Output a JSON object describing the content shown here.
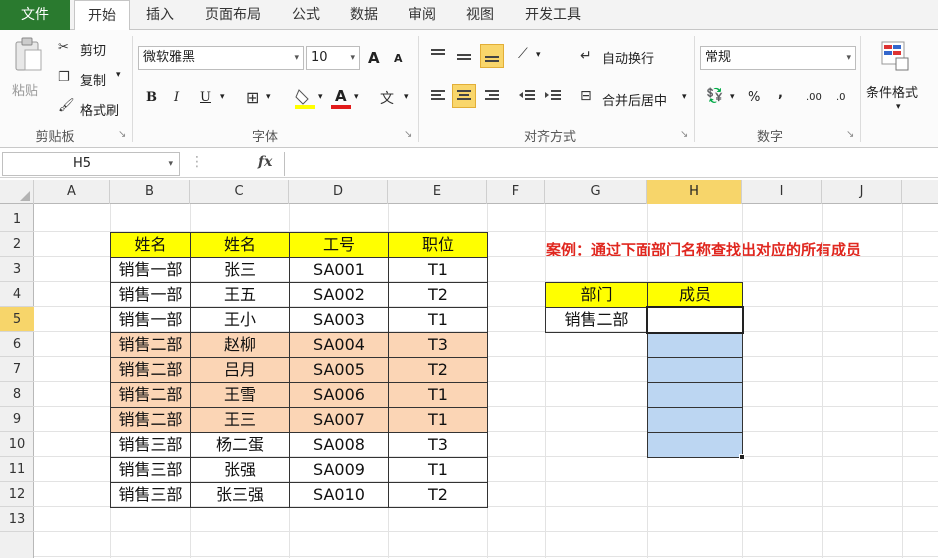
{
  "tabs": [
    "文件",
    "开始",
    "插入",
    "页面布局",
    "公式",
    "数据",
    "审阅",
    "视图",
    "开发工具"
  ],
  "clipboard": {
    "paste": "粘贴",
    "cut": "剪切",
    "copy": "复制",
    "format_painter": "格式刷",
    "group": "剪贴板"
  },
  "font": {
    "name": "微软雅黑",
    "size": "10",
    "grow": "A",
    "shrink": "A",
    "bold": "B",
    "italic": "I",
    "underline": "U",
    "group": "字体"
  },
  "alignment": {
    "wrap": "自动换行",
    "merge": "合并后居中",
    "group": "对齐方式"
  },
  "number": {
    "format": "常规",
    "percent": "%",
    "comma": ",",
    "inc": ".00",
    "dec": ".0",
    "group": "数字"
  },
  "styles": {
    "conditional": "条件格式"
  },
  "namebox": "H5",
  "fx": "fx",
  "columns": [
    "A",
    "B",
    "C",
    "D",
    "E",
    "F",
    "G",
    "H",
    "I",
    "J"
  ],
  "rows": [
    "1",
    "2",
    "3",
    "4",
    "5",
    "6",
    "7",
    "8",
    "9",
    "10",
    "11",
    "12",
    "13"
  ],
  "table": {
    "headers": [
      "姓名",
      "姓名",
      "工号",
      "职位"
    ],
    "rows": [
      [
        "销售一部",
        "张三",
        "SA001",
        "T1"
      ],
      [
        "销售一部",
        "王五",
        "SA002",
        "T2"
      ],
      [
        "销售一部",
        "王小",
        "SA003",
        "T1"
      ],
      [
        "销售二部",
        "赵柳",
        "SA004",
        "T3"
      ],
      [
        "销售二部",
        "吕月",
        "SA005",
        "T2"
      ],
      [
        "销售二部",
        "王雪",
        "SA006",
        "T1"
      ],
      [
        "销售二部",
        "王三",
        "SA007",
        "T1"
      ],
      [
        "销售三部",
        "杨二蛋",
        "SA008",
        "T3"
      ],
      [
        "销售三部",
        "张强",
        "SA009",
        "T1"
      ],
      [
        "销售三部",
        "张三强",
        "SA010",
        "T2"
      ]
    ]
  },
  "caption": "案例：通过下面部门名称查找出对应的所有成员",
  "lookup": {
    "dept_header": "部门",
    "member_header": "成员",
    "dept_value": "销售二部"
  },
  "colors": {
    "header_fill": "#ffff00",
    "highlight_fill": "#fbd5b5",
    "result_fill": "#bcd6f2",
    "caption": "#e0271f",
    "file_tab": "#2a7a2f"
  }
}
